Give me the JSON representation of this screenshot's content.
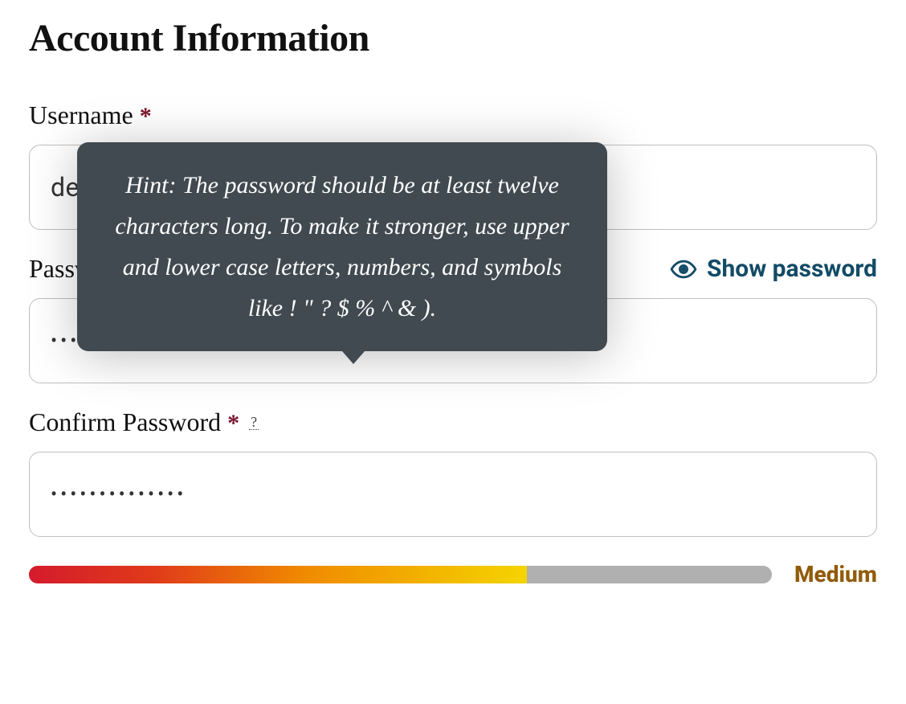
{
  "section_title": "Account Information",
  "fields": {
    "username": {
      "label": "Username",
      "required_mark": "*",
      "value": "demouser"
    },
    "password": {
      "label": "Password",
      "required_mark": "*",
      "hint_trigger": "?",
      "show_label": "Show password",
      "value": "••••••••••••••"
    },
    "confirm": {
      "label": "Confirm Password",
      "required_mark": "*",
      "hint_trigger": "?",
      "value": "••••••••••••••"
    }
  },
  "tooltip": {
    "text": "Hint: The password should be at least twelve characters long. To make it stronger, use upper and lower case letters, numbers, and symbols like ! \" ? $ % ^ & )."
  },
  "strength": {
    "percent": 67,
    "label": "Medium",
    "color": "#915b09"
  }
}
